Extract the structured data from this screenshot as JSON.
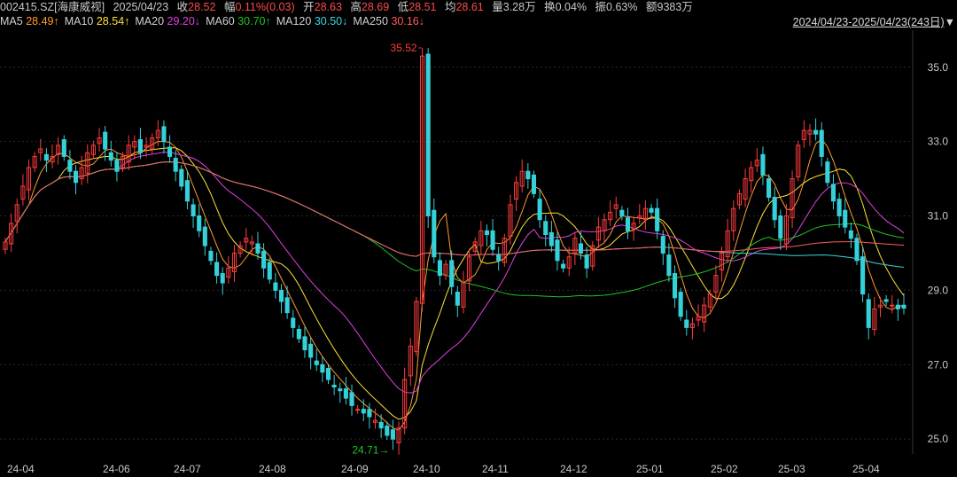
{
  "header": {
    "code": "002415.SZ",
    "name": "[海康威视]",
    "date": "2025/04/23",
    "close_label": "收",
    "close": "28.52",
    "change_label": "幅",
    "change": "0.11%(0.03)",
    "open_label": "开",
    "open": "28.63",
    "high_label": "高",
    "high": "28.69",
    "low_label": "低",
    "low": "28.51",
    "avg_label": "均",
    "avg": "28.61",
    "volume_label": "量",
    "volume": "3.28万",
    "turnover_label": "换",
    "turnover": "0.04%",
    "amplitude_label": "振",
    "amplitude": "0.63%",
    "amount_label": "额",
    "amount": "9383万"
  },
  "ma_legend": [
    {
      "label": "MA5",
      "value": "28.49↑",
      "color": "#ff9a2e"
    },
    {
      "label": "MA10",
      "value": "28.54↑",
      "color": "#ffe135"
    },
    {
      "label": "MA20",
      "value": "29.20↓",
      "color": "#e040e0"
    },
    {
      "label": "MA60",
      "value": "30.70↑",
      "color": "#22c422"
    },
    {
      "label": "MA120",
      "value": "30.50↓",
      "color": "#38d7e0"
    },
    {
      "label": "MA250",
      "value": "30.16↓",
      "color": "#ff5a5a"
    }
  ],
  "range_selector": {
    "text": "2024/04/23-2025/04/23(243日)",
    "icon": "triangle-down-icon"
  },
  "colors": {
    "up": "#ff3b3b",
    "down": "#35d0d8",
    "grid": "#2a2a2a",
    "axis_text": "#c8c8c8",
    "background": "#000000"
  },
  "chart_data": {
    "type": "candlestick",
    "ylim": [
      24.6,
      35.9
    ],
    "y_ticks": [
      "35.0",
      "33.0",
      "31.0",
      "29.0",
      "27.0",
      "25.0"
    ],
    "x_tick_labels": [
      "24-04",
      "24-06",
      "24-07",
      "24-08",
      "24-09",
      "24-10",
      "24-11",
      "24-12",
      "25-01",
      "25-02",
      "25-03",
      "25-04"
    ],
    "annotations": {
      "max_label": "35.52",
      "min_label": "24.71→"
    },
    "closes": [
      30.3,
      30.8,
      31.3,
      31.8,
      32.3,
      32.6,
      32.8,
      32.5,
      32.6,
      32.9,
      32.6,
      32.2,
      31.9,
      32.3,
      32.7,
      32.9,
      33.1,
      32.8,
      32.5,
      32.2,
      32.6,
      32.9,
      33.0,
      32.7,
      32.9,
      33.1,
      33.3,
      33.0,
      32.6,
      32.2,
      31.8,
      31.4,
      31.0,
      30.6,
      30.2,
      29.8,
      29.4,
      29.2,
      29.6,
      30.0,
      30.2,
      30.4,
      30.3,
      30.0,
      29.6,
      29.3,
      29.0,
      28.7,
      28.4,
      28.0,
      27.7,
      27.4,
      27.2,
      27.0,
      26.8,
      26.6,
      26.4,
      26.3,
      26.1,
      25.9,
      25.8,
      25.7,
      25.6,
      25.5,
      25.3,
      25.1,
      25.0,
      25.3,
      26.6,
      27.5,
      28.7,
      35.3,
      31.0,
      29.9,
      29.4,
      29.7,
      29.1,
      28.6,
      29.2,
      29.9,
      30.3,
      30.6,
      30.5,
      30.1,
      29.8,
      30.4,
      31.3,
      31.9,
      32.2,
      32.0,
      31.6,
      30.9,
      30.5,
      30.2,
      29.8,
      29.6,
      29.9,
      30.4,
      30.0,
      29.6,
      30.2,
      30.7,
      30.9,
      31.1,
      31.3,
      31.0,
      30.6,
      30.8,
      31.0,
      31.2,
      31.1,
      30.6,
      30.0,
      29.4,
      28.8,
      28.3,
      28.0,
      28.1,
      28.3,
      28.6,
      28.9,
      29.4,
      30.0,
      30.6,
      31.2,
      31.6,
      32.0,
      32.3,
      32.5,
      32.1,
      31.5,
      30.9,
      30.4,
      31.0,
      32.0,
      32.9,
      33.3,
      33.3,
      33.2,
      32.6,
      31.9,
      31.4,
      31.0,
      30.7,
      30.4,
      29.8,
      28.9,
      28.0,
      28.5,
      28.6,
      28.7,
      28.6,
      28.5,
      28.52
    ],
    "ma_series": [
      "MA5",
      "MA10",
      "MA20",
      "MA60",
      "MA120",
      "MA250"
    ]
  }
}
